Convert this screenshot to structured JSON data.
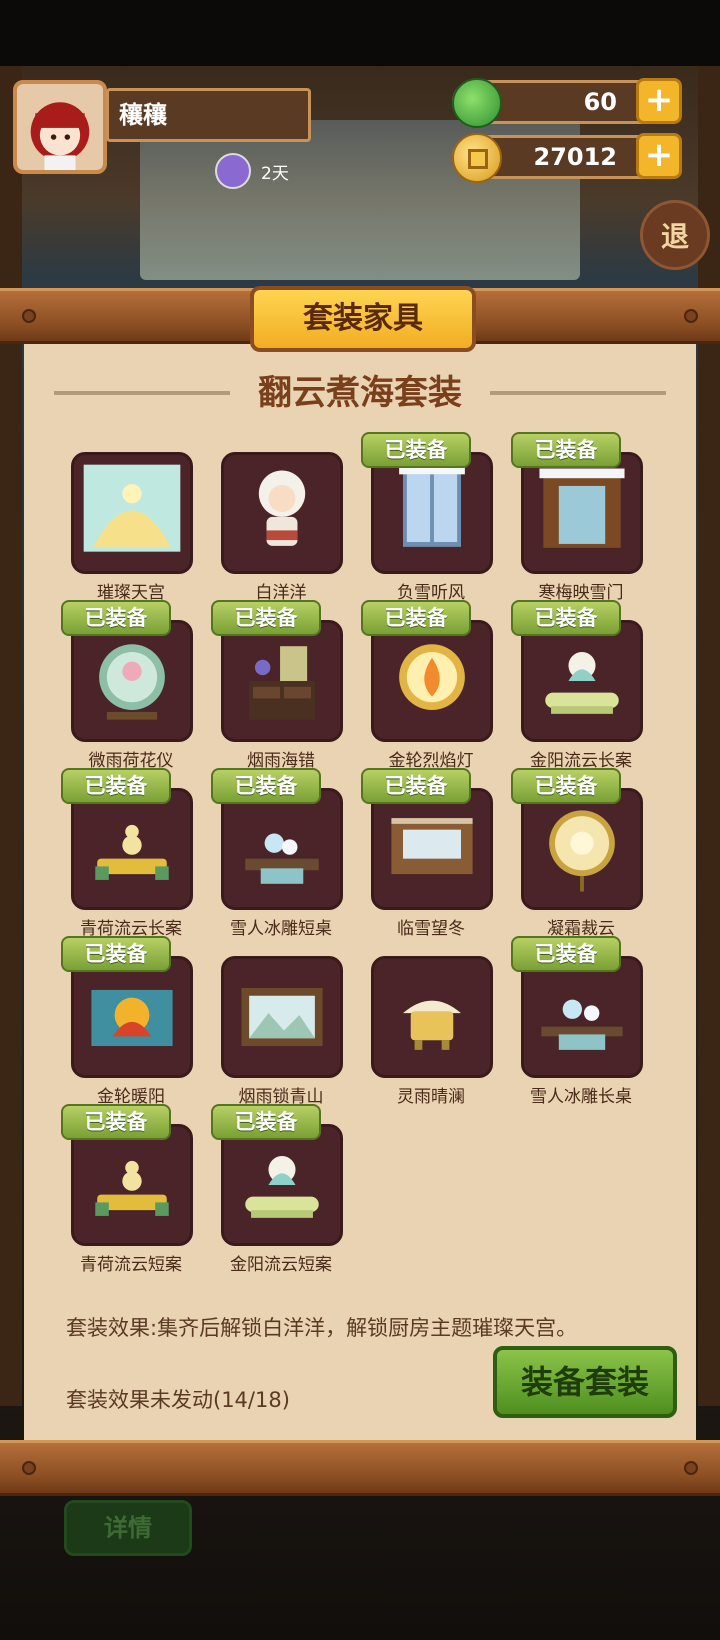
{
  "header": {
    "player_name": "穰穰",
    "streak_text": "2天",
    "jade": "60",
    "coins": "27012",
    "plus": "+"
  },
  "background": {
    "retreat_label": "退"
  },
  "panel": {
    "tab_title": "套装家具",
    "set_name": "翻云煮海套装",
    "equipped_badge": "已装备",
    "effect_description": "套装效果:集齐后解锁白洋洋，解锁厨房主题璀璨天宫。",
    "effect_status": "套装效果未发动(14/18)",
    "equip_button": "装备套装"
  },
  "items": [
    {
      "name": "璀璨天宫",
      "equipped": false,
      "icon": "palace-scene"
    },
    {
      "name": "白洋洋",
      "equipped": false,
      "icon": "sheep-character"
    },
    {
      "name": "负雪听风",
      "equipped": true,
      "icon": "snow-window"
    },
    {
      "name": "寒梅映雪门",
      "equipped": true,
      "icon": "snow-gate"
    },
    {
      "name": "微雨荷花仪",
      "equipped": true,
      "icon": "lotus-orb"
    },
    {
      "name": "烟雨海错",
      "equipped": true,
      "icon": "cabinet"
    },
    {
      "name": "金轮烈焰灯",
      "equipped": true,
      "icon": "flame-lamp"
    },
    {
      "name": "金阳流云长案",
      "equipped": true,
      "icon": "cloud-table"
    },
    {
      "name": "青荷流云长案",
      "equipped": true,
      "icon": "gourd-table"
    },
    {
      "name": "雪人冰雕短桌",
      "equipped": true,
      "icon": "snowman-table"
    },
    {
      "name": "临雪望冬",
      "equipped": true,
      "icon": "winter-window"
    },
    {
      "name": "凝霜裁云",
      "equipped": true,
      "icon": "cloud-lantern"
    },
    {
      "name": "金轮暖阳",
      "equipped": true,
      "icon": "sun-painting"
    },
    {
      "name": "烟雨锁青山",
      "equipped": false,
      "icon": "mountain-window"
    },
    {
      "name": "灵雨晴澜",
      "equipped": false,
      "icon": "incense-burner"
    },
    {
      "name": "雪人冰雕长桌",
      "equipped": true,
      "icon": "snowman-long-table"
    },
    {
      "name": "青荷流云短案",
      "equipped": true,
      "icon": "gourd-short-table"
    },
    {
      "name": "金阳流云短案",
      "equipped": true,
      "icon": "cloud-short-table"
    }
  ],
  "footer": {
    "detail_button": "详情"
  }
}
